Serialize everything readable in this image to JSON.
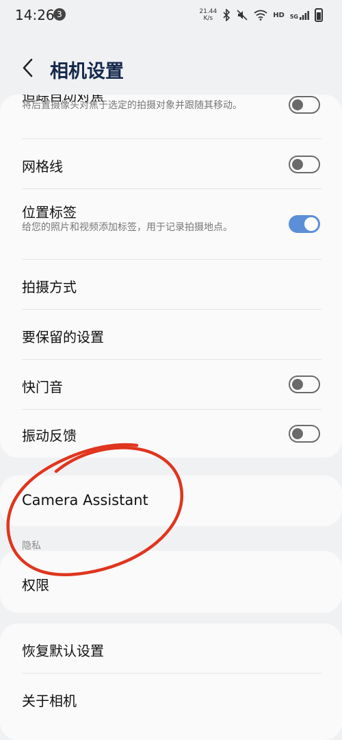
{
  "status_bar": {
    "time": "14:26",
    "notification_count": "3",
    "net_speed_value": "21.44",
    "net_speed_unit": "K/s",
    "hd_label": "HD",
    "network_type": "5G"
  },
  "header": {
    "title": "相机设置"
  },
  "settings": {
    "tracking_autofocus": {
      "title_partial": "追踪自动对焦",
      "subtitle": "将后置摄像头对焦于选定的拍摄对象并跟随其移动。",
      "toggle": "off"
    },
    "grid_lines": {
      "title": "网格线",
      "toggle": "off"
    },
    "location_tags": {
      "title": "位置标签",
      "subtitle": "给您的照片和视频添加标签，用于记录拍摄地点。",
      "toggle": "on"
    },
    "shooting_methods": {
      "title": "拍摄方式"
    },
    "settings_to_keep": {
      "title": "要保留的设置"
    },
    "shutter_sound": {
      "title": "快门音",
      "toggle": "off"
    },
    "vibration_feedback": {
      "title": "振动反馈",
      "toggle": "off"
    }
  },
  "camera_assistant": {
    "title": "Camera Assistant"
  },
  "privacy": {
    "section_label": "隐私",
    "permissions": {
      "title": "权限"
    }
  },
  "general": {
    "reset_settings": {
      "title": "恢复默认设置"
    },
    "about_camera": {
      "title": "关于相机"
    }
  },
  "colors": {
    "title_color": "#15284b",
    "toggle_on": "#5b8fd8",
    "annotation_red": "#e0351e"
  }
}
